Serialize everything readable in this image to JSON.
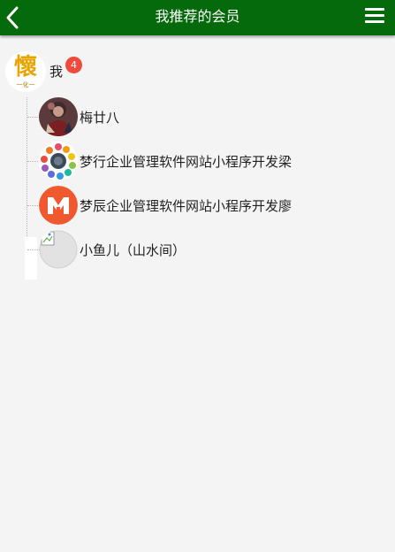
{
  "header": {
    "title": "我推荐的会员",
    "back_icon": "chevron-left-icon",
    "menu_icon": "hamburger-menu-icon",
    "background": "#046a0b"
  },
  "root": {
    "name": "我",
    "badge_count": "4",
    "avatar_text": "懷",
    "avatar_subtext": "一化一",
    "badge_color": "#f04a3d"
  },
  "members": [
    {
      "name": "梅廿八"
    },
    {
      "name": "梦行企业管理软件网站小程序开发梁"
    },
    {
      "name": "梦辰企业管理软件网站小程序开发廖"
    },
    {
      "name": "小鱼儿（山水间）"
    }
  ]
}
